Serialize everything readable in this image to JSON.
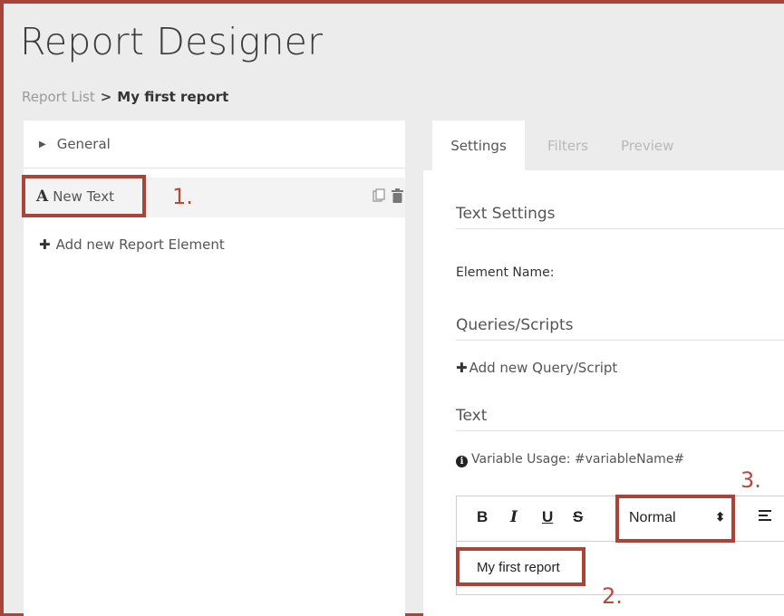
{
  "app": {
    "title": "Report Designer"
  },
  "breadcrumb": {
    "parent": "Report List",
    "separator": ">",
    "current": "My first report"
  },
  "left": {
    "general_label": "General",
    "element": {
      "icon_letter": "A",
      "label": "New Text",
      "icons": [
        "copy-icon",
        "trash-icon"
      ]
    },
    "add_element_label": "Add new Report Element"
  },
  "tabs": [
    {
      "label": "Settings",
      "active": true
    },
    {
      "label": "Filters",
      "active": false
    },
    {
      "label": "Preview",
      "active": false
    }
  ],
  "settings": {
    "text_settings_heading": "Text Settings",
    "element_name_label": "Element Name:",
    "queries_heading": "Queries/Scripts",
    "add_query_label": "Add new Query/Script",
    "text_heading": "Text",
    "variable_usage": "Variable Usage: #variableName#"
  },
  "editor": {
    "bold": "B",
    "italic": "I",
    "underline": "U",
    "strike": "S",
    "format_value": "Normal",
    "format_arrows": "⬍",
    "content": "My first report"
  },
  "annotations": {
    "one": "1.",
    "two": "2.",
    "three": "3."
  },
  "colors": {
    "annotation": "#a9443a",
    "background": "#ececec",
    "frame": "#3a3a3a"
  }
}
